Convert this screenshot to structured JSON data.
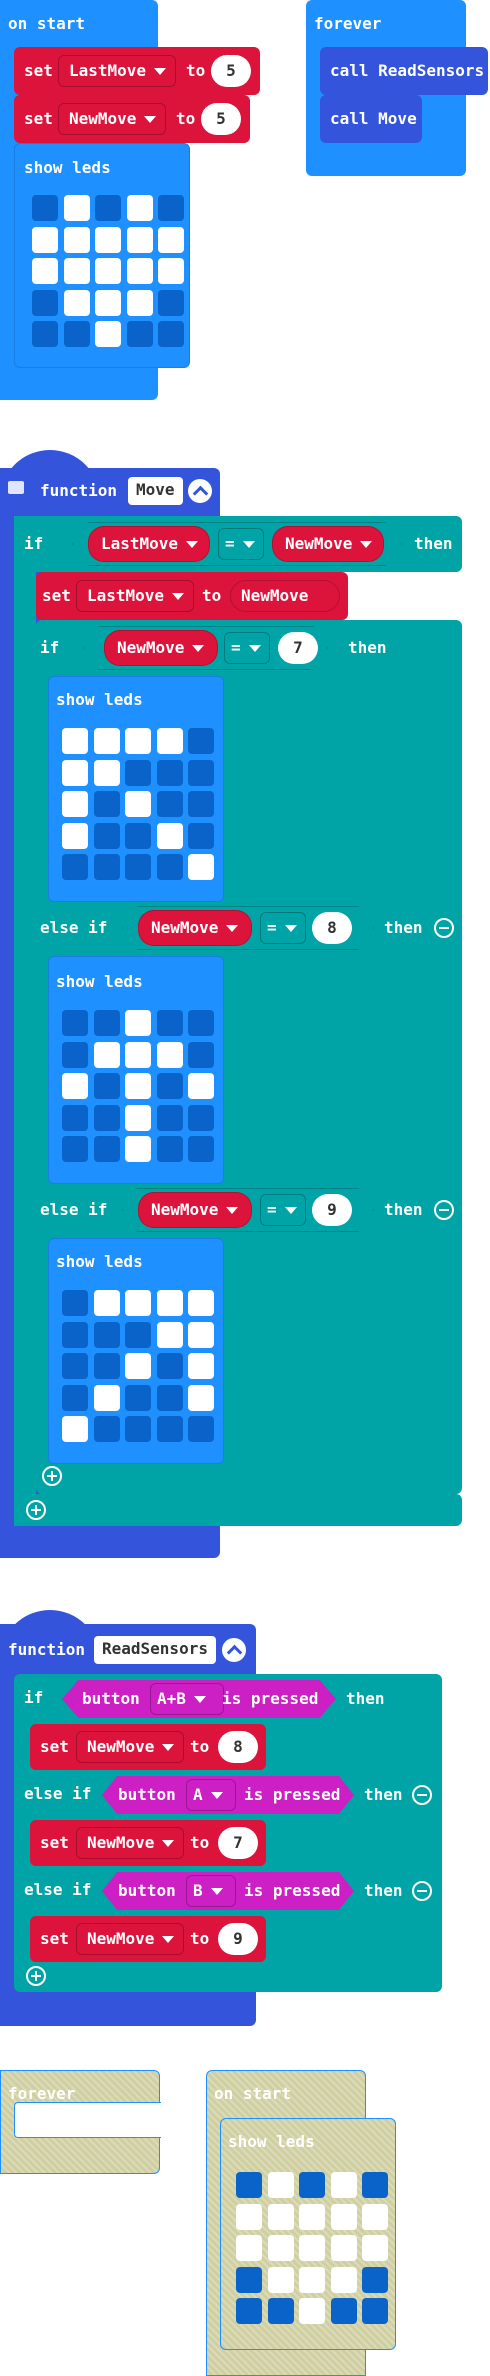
{
  "block1": {
    "hat": "on start",
    "set1": {
      "kw": "set",
      "var": "LastMove",
      "to": "to",
      "val": "5"
    },
    "set2": {
      "kw": "set",
      "var": "NewMove",
      "to": "to",
      "val": "5"
    },
    "leds_label": "show leds",
    "leds": [
      [
        0,
        1,
        0,
        1,
        0
      ],
      [
        1,
        1,
        1,
        1,
        1
      ],
      [
        1,
        1,
        1,
        1,
        1
      ],
      [
        0,
        1,
        1,
        1,
        0
      ],
      [
        0,
        0,
        1,
        0,
        0
      ]
    ]
  },
  "block2": {
    "hat": "forever",
    "call1": "call ReadSensors",
    "call2": "call Move"
  },
  "move": {
    "kw": "function",
    "name": "Move",
    "if_kw": "if",
    "then": "then",
    "cmp_left": "LastMove",
    "cmp_op": "=",
    "cmp_right": "NewMove",
    "set": {
      "kw": "set",
      "var": "LastMove",
      "to": "to",
      "val": "NewMove"
    },
    "inner_if": "if",
    "else_if": "else if",
    "var": "NewMove",
    "case1": {
      "val": "7",
      "leds_label": "show leds",
      "leds": [
        [
          1,
          1,
          1,
          1,
          0
        ],
        [
          1,
          1,
          0,
          0,
          0
        ],
        [
          1,
          0,
          1,
          0,
          0
        ],
        [
          1,
          0,
          0,
          1,
          0
        ],
        [
          0,
          0,
          0,
          0,
          1
        ]
      ]
    },
    "case2": {
      "val": "8",
      "leds_label": "show leds",
      "leds": [
        [
          0,
          0,
          1,
          0,
          0
        ],
        [
          0,
          1,
          1,
          1,
          0
        ],
        [
          1,
          0,
          1,
          0,
          1
        ],
        [
          0,
          0,
          1,
          0,
          0
        ],
        [
          0,
          0,
          1,
          0,
          0
        ]
      ]
    },
    "case3": {
      "val": "9",
      "leds_label": "show leds",
      "leds": [
        [
          0,
          1,
          1,
          1,
          1
        ],
        [
          0,
          0,
          0,
          1,
          1
        ],
        [
          0,
          0,
          1,
          0,
          1
        ],
        [
          0,
          1,
          0,
          0,
          1
        ],
        [
          1,
          0,
          0,
          0,
          0
        ]
      ]
    }
  },
  "read": {
    "kw": "function",
    "name": "ReadSensors",
    "if_kw": "if",
    "else_if": "else if",
    "then": "then",
    "button_kw": "button",
    "pressed": "is pressed",
    "set_kw": "set",
    "to": "to",
    "var": "NewMove",
    "cases": [
      {
        "button": "A+B",
        "val": "8"
      },
      {
        "button": "A",
        "val": "7"
      },
      {
        "button": "B",
        "val": "9"
      }
    ]
  },
  "ghost_forever": {
    "hat": "forever"
  },
  "ghost_start": {
    "hat": "on start",
    "leds_label": "show leds",
    "leds": [
      [
        0,
        1,
        0,
        1,
        0
      ],
      [
        1,
        1,
        1,
        1,
        1
      ],
      [
        1,
        1,
        1,
        1,
        1
      ],
      [
        0,
        1,
        1,
        1,
        0
      ],
      [
        0,
        0,
        1,
        0,
        0
      ]
    ]
  }
}
